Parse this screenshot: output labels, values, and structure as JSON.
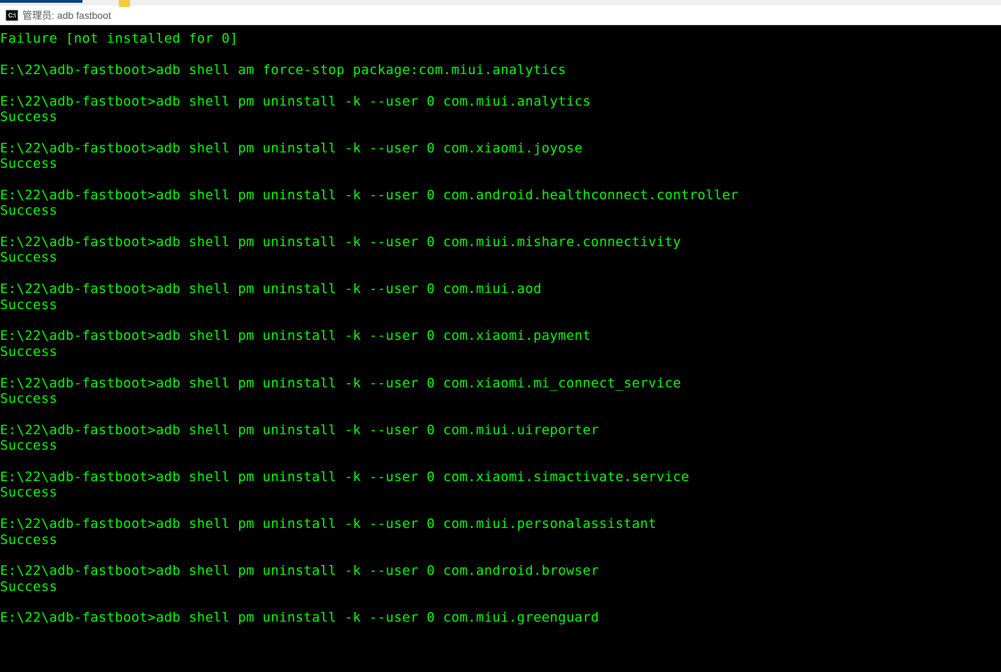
{
  "window": {
    "icon_label": "C:\\",
    "title_prefix": "管理员: ",
    "title": "adb fastboot"
  },
  "terminal": {
    "prompt": "E:\\22\\adb-fastboot>",
    "failure_line": "Failure [not installed for 0]",
    "success": "Success",
    "commands": [
      {
        "cmd": "adb shell am force-stop package:com.miui.analytics",
        "result": ""
      },
      {
        "cmd": "adb shell pm uninstall -k --user 0 com.miui.analytics",
        "result": "Success"
      },
      {
        "cmd": "adb shell pm uninstall -k --user 0 com.xiaomi.joyose",
        "result": "Success"
      },
      {
        "cmd": "adb shell pm uninstall -k --user 0 com.android.healthconnect.controller",
        "result": "Success"
      },
      {
        "cmd": "adb shell pm uninstall -k --user 0 com.miui.mishare.connectivity",
        "result": "Success"
      },
      {
        "cmd": "adb shell pm uninstall -k --user 0 com.miui.aod",
        "result": "Success"
      },
      {
        "cmd": "adb shell pm uninstall -k --user 0 com.xiaomi.payment",
        "result": "Success"
      },
      {
        "cmd": "adb shell pm uninstall -k --user 0 com.xiaomi.mi_connect_service",
        "result": "Success"
      },
      {
        "cmd": "adb shell pm uninstall -k --user 0 com.miui.uireporter",
        "result": "Success"
      },
      {
        "cmd": "adb shell pm uninstall -k --user 0 com.xiaomi.simactivate.service",
        "result": "Success"
      },
      {
        "cmd": "adb shell pm uninstall -k --user 0 com.miui.personalassistant",
        "result": "Success"
      },
      {
        "cmd": "adb shell pm uninstall -k --user 0 com.android.browser",
        "result": "Success"
      },
      {
        "cmd": "adb shell pm uninstall -k --user 0 com.miui.greenguard",
        "result": ""
      }
    ]
  }
}
